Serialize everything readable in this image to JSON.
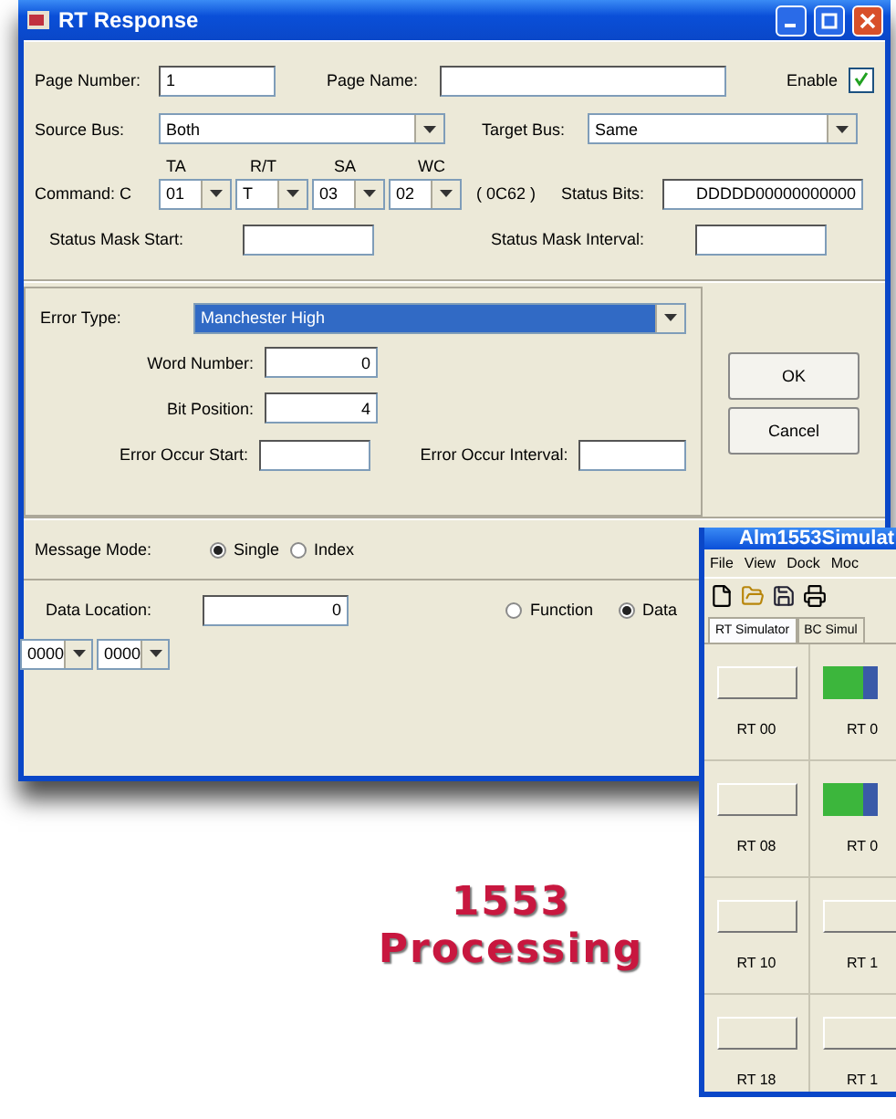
{
  "window": {
    "title": "RT Response"
  },
  "page_number": {
    "label": "Page Number:",
    "value": "1"
  },
  "page_name": {
    "label": "Page Name:"
  },
  "enable": {
    "label": "Enable",
    "checked": true
  },
  "source_bus": {
    "label": "Source Bus:",
    "value": "Both"
  },
  "target_bus": {
    "label": "Target Bus:",
    "value": "Same"
  },
  "command": {
    "label": "Command:  C",
    "code": "( 0C62 )",
    "fields": [
      {
        "label": "TA",
        "value": "01"
      },
      {
        "label": "R/T",
        "value": "T"
      },
      {
        "label": "SA",
        "value": "03"
      },
      {
        "label": "WC",
        "value": "02"
      }
    ]
  },
  "status_bits": {
    "label": "Status Bits:",
    "value": "DDDDD00000000000"
  },
  "status_mask_start": {
    "label": "Status Mask Start:"
  },
  "status_mask_interval": {
    "label": "Status Mask Interval:"
  },
  "error_type": {
    "label": "Error Type:",
    "value": "Manchester High"
  },
  "word_number": {
    "label": "Word Number:",
    "value": "0"
  },
  "bit_position": {
    "label": "Bit Position:",
    "value": "4"
  },
  "error_occur_start": {
    "label": "Error Occur Start:"
  },
  "error_occur_interval": {
    "label": "Error Occur Interval:"
  },
  "buttons": [
    "OK",
    "Cancel"
  ],
  "message_mode": {
    "label": "Message Mode:",
    "options": [
      {
        "label": "Single",
        "selected": true
      },
      {
        "label": "Index",
        "selected": false
      }
    ]
  },
  "data_location": {
    "label": "Data Location:",
    "value": "0"
  },
  "location_type": {
    "options": [
      {
        "label": "Function",
        "selected": false
      },
      {
        "label": "Data",
        "selected": true
      }
    ]
  },
  "data_combos": [
    "0000",
    "0000"
  ],
  "simulator": {
    "title": "Alm1553Simulat",
    "menu": [
      "File",
      "View",
      "Dock",
      "Moc"
    ],
    "tabs": [
      {
        "label": "RT Simulator",
        "selected": true
      },
      {
        "label": "BC Simul",
        "selected": false
      }
    ],
    "cells": [
      {
        "label": "RT 00",
        "active": false
      },
      {
        "label": "RT 0",
        "active": true
      },
      {
        "label": "RT 08",
        "active": false
      },
      {
        "label": "RT 0",
        "active": true
      },
      {
        "label": "RT 10",
        "active": false
      },
      {
        "label": "RT 1",
        "active": false
      },
      {
        "label": "RT 18",
        "active": false
      },
      {
        "label": "RT 1",
        "active": false
      }
    ]
  },
  "caption_lines": [
    "1553",
    "Processing"
  ]
}
